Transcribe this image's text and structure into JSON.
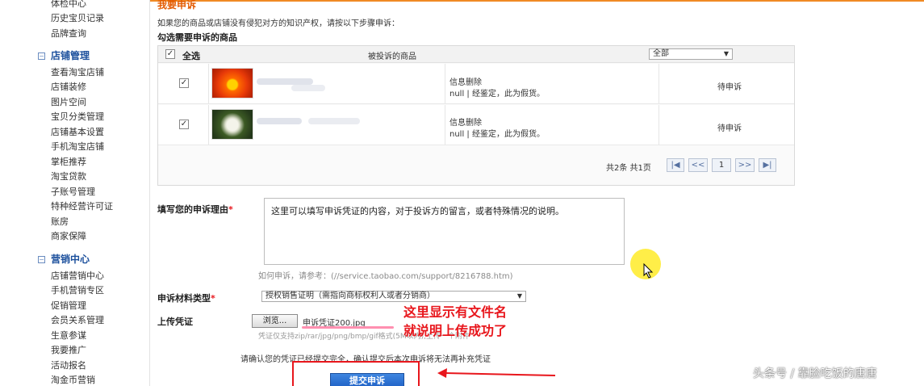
{
  "sidebar": {
    "items_top": [
      "体检中心",
      "历史宝贝记录",
      "品牌查询"
    ],
    "group_shop": "店铺管理",
    "items_shop": [
      "查看淘宝店铺",
      "店铺装修",
      "图片空间",
      "宝贝分类管理",
      "店铺基本设置",
      "手机淘宝店铺",
      "掌柜推荐",
      "淘宝贷款",
      "子账号管理",
      "特种经营许可证",
      "账房",
      "商家保障"
    ],
    "group_marketing": "营销中心",
    "items_marketing": [
      "店铺营销中心",
      "手机营销专区",
      "促销管理",
      "会员关系管理",
      "生意参谋",
      "我要推广",
      "活动报名",
      "淘金币营销"
    ]
  },
  "main": {
    "title": "我要申诉",
    "intro": "如果您的商品或店铺没有侵犯对方的知识产权，请按以下步骤申诉：",
    "select_label": "勾选需要申诉的商品",
    "table": {
      "select_all": "全选",
      "col_goods": "被投诉的商品",
      "filter_value": "全部",
      "rows": [
        {
          "checked": "✓",
          "info_title": "信息删除",
          "info_detail": "null | 经鉴定，此为假货。",
          "status": "待申诉"
        },
        {
          "checked": "✓",
          "info_title": "信息删除",
          "info_detail": "null | 经鉴定，此为假货。",
          "status": "待申诉"
        }
      ],
      "pagination": {
        "summary": "共2条 共1页",
        "first": "|◀",
        "prev": "<<",
        "current": "1",
        "next": ">>",
        "last": "▶|"
      }
    },
    "reason_label": "填写您的申诉理由",
    "required_mark": "*",
    "reason_text": "这里可以填写申诉凭证的内容，对于投诉方的留言，或者特殊情况的说明。",
    "help_text": "如何申诉，请参考：(//service.taobao.com/support/8216788.htm)",
    "material_label": "申诉材料类型",
    "material_value": "授权销售证明（需指向商标权利人或者分销商）",
    "upload_label": "上传凭证",
    "browse_label": "浏览...",
    "file_name": "申诉凭证200.jpg",
    "upload_hint": "凭证仅支持zip/rar/jpg/png/bmp/gif格式(5M以内),上传一个附件",
    "confirm_text": "请确认您的凭证已经提交完全，确认提交后本次申诉将无法再补充凭证",
    "submit_label": "提交申诉"
  },
  "annotation": {
    "line1": "这里显示有文件名",
    "line2": "就说明上传成功了",
    "color": "#e8161c"
  },
  "watermark": "头条号 / 靠脸吃饭的唐唐",
  "colors": {
    "accent_orange": "#e35a00",
    "sidebar_group": "#1b4f9c",
    "submit_blue": "#1d5fc4"
  }
}
